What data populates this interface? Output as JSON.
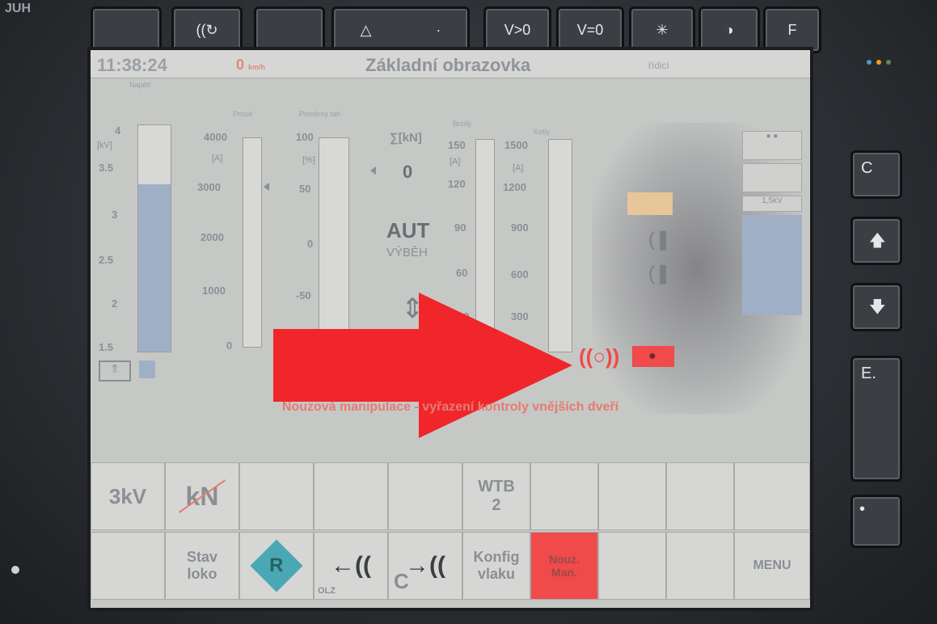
{
  "device": {
    "brand": "JUH"
  },
  "top_keys": [
    {
      "label": "",
      "icon": "blank-key-icon"
    },
    {
      "label": "",
      "icon": "horn-icon"
    },
    {
      "label": "",
      "icon": "blank-key-icon"
    },
    {
      "label": "",
      "icon": "warning-triangle-icon"
    },
    {
      "label": "V>0",
      "icon": ""
    },
    {
      "label": "V=0",
      "icon": ""
    },
    {
      "label": "",
      "icon": "brightness-icon"
    },
    {
      "label": "",
      "icon": "contrast-icon"
    },
    {
      "label": "F",
      "icon": ""
    }
  ],
  "side_keys": [
    {
      "label": "C",
      "icon": ""
    },
    {
      "label": "",
      "icon": "arrow-up-icon"
    },
    {
      "label": "",
      "icon": "arrow-down-icon"
    },
    {
      "label": "E.",
      "icon": ""
    },
    {
      "label": "",
      "icon": "dot-icon"
    }
  ],
  "status": {
    "time": "11:38:24",
    "speed_value": "0",
    "speed_unit": "km/h",
    "screen_title": "Základní obrazovka",
    "role": "řídicí"
  },
  "panels": {
    "napeti": {
      "label": "Napětí",
      "unit": "[kV]",
      "ticks": [
        "4",
        "3.5",
        "3",
        "2.5",
        "2",
        "1.5"
      ],
      "fill_level": 0.74
    },
    "proud": {
      "label": "Proud",
      "unit": "[A]",
      "ticks": [
        "4000",
        "3000",
        "2000",
        "1000",
        "0"
      ]
    },
    "tah": {
      "label": "Poměrný tah",
      "unit": "[%]",
      "ticks": [
        "100",
        "50",
        "0",
        "-50"
      ]
    },
    "sum": {
      "label": "∑[kN]",
      "value": "0"
    },
    "mode": {
      "main": "AUT",
      "sub": "VÝBĚH"
    },
    "brzdy": {
      "label": "Brzdy",
      "unit": "[A]",
      "ticks": [
        "150",
        "120",
        "90",
        "60",
        "30"
      ]
    },
    "kotly": {
      "label": "Kotly",
      "unit": "[A]",
      "ticks": [
        "1500",
        "1200",
        "900",
        "600",
        "300"
      ]
    },
    "right_status": "1,5kV"
  },
  "message": "Nouzová manipulace - vyřazení kontroly vnějších dveří",
  "softkeys_row1": [
    "3kV",
    "kN",
    "",
    "",
    "",
    "WTB\n2",
    "",
    "",
    "",
    ""
  ],
  "softkeys_row2": [
    "",
    "Stav\nloko",
    "R",
    "OLZ",
    "C",
    "Konfig\nvlaku",
    "Nouz.\nMan.",
    "",
    "",
    "MENU"
  ],
  "colors": {
    "alert": "#f04a4a",
    "message": "#e67b70",
    "gauge_fill": "#9fb0c6"
  }
}
